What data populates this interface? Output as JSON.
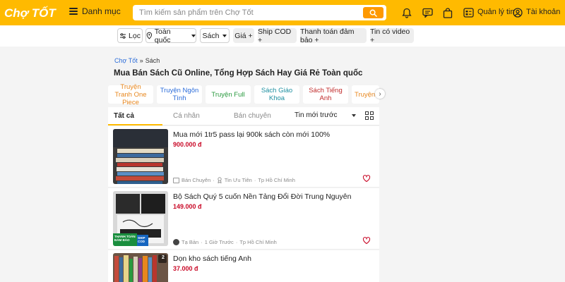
{
  "header": {
    "logo_text": "Chợ TỐT",
    "menu_label": "Danh mục",
    "search_placeholder": "Tìm kiếm sản phẩm trên Chợ Tốt",
    "manage_label": "Quản lý tin",
    "account_label": "Tài khoản",
    "icons": [
      "bell-icon",
      "chat-icon",
      "bag-icon",
      "manage-icon",
      "account-icon"
    ]
  },
  "filters": {
    "filter_label": "Lọc",
    "location_label": "Toàn quốc",
    "category_label": "Sách",
    "price_label": "Giá +",
    "ship_label": "Ship COD +",
    "payment_label": "Thanh toán đảm bảo +",
    "video_label": "Tin có video +"
  },
  "breadcrumb": {
    "home": "Chợ Tốt",
    "separator": "»",
    "current": "Sách"
  },
  "page_title": "Mua Bán Sách Cũ Online, Tổng Hợp Sách Hay Giá Rẻ Toàn quốc",
  "categories": [
    {
      "label": "Truyện Tranh One Piece",
      "color": "#e8871e"
    },
    {
      "label": "Truyện Ngôn Tình",
      "color": "#2b6cd9"
    },
    {
      "label": "Truyện Full",
      "color": "#2a9a3f"
    },
    {
      "label": "Sách Giáo Khoa",
      "color": "#1e8fa0"
    },
    {
      "label": "Sách Tiếng Anh",
      "color": "#c02a2a"
    },
    {
      "label": "Truyện",
      "color": "#e8871e"
    }
  ],
  "tabs": {
    "all": "Tất cả",
    "personal": "Cá nhân",
    "professional": "Bán chuyên",
    "sort": "Tin mới trước"
  },
  "listings": [
    {
      "title": "Mua mới 1tr5 pass lại 900k sách còn mới 100%",
      "price": "900.000 đ",
      "seller": "Bán Chuyên",
      "badge": "Tin Ưu Tiên",
      "location": "Tp Hồ Chí Minh"
    },
    {
      "title": "Bộ Sách Quý 5 cuốn Nền Tảng Đổi Đời Trung Nguyên",
      "price": "149.000 đ",
      "seller": "Tạ Bản",
      "time": "1 Giờ Trước",
      "location": "Tp Hồ Chí Minh",
      "thumb_tag_1": "THANH TOÁN ĐẢM BẢO",
      "thumb_tag_2": "SHIP COD"
    },
    {
      "title": "Dọn kho sách tiếng Anh",
      "price": "37.000 đ",
      "thumb_count": "2"
    }
  ],
  "colors": {
    "brand": "#ffba00",
    "search_button": "#fe9900",
    "price": "#c90927",
    "link": "#2b6cd9"
  }
}
